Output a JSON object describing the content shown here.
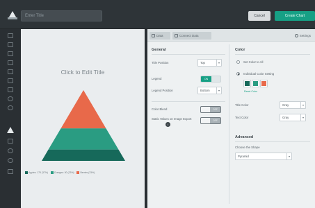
{
  "topbar": {
    "title_placeholder": "Enter Title",
    "cancel_label": "Cancel",
    "create_label": "Create Chart"
  },
  "rail": {
    "icons": [
      "bar-chart-icon",
      "column-chart-icon",
      "stacked-chart-icon",
      "line-chart-icon",
      "area-chart-icon",
      "scatter-icon",
      "bubble-icon",
      "pie-chart-icon",
      "donut-chart-icon",
      "pyramid-chart-icon",
      "funnel-chart-icon",
      "gauge-icon",
      "radar-chart-icon",
      "table-icon"
    ],
    "active_index": 9
  },
  "canvas": {
    "title": "Click to Edit Title",
    "legend": [
      {
        "label": "Apples: 175 (37%)",
        "color": "#16695a"
      },
      {
        "label": "Oranges: 50 (23%)",
        "color": "#2a9c82"
      },
      {
        "label": "Berries (33%)",
        "color": "#e8694a"
      }
    ]
  },
  "chart_data": {
    "type": "pyramid",
    "series": [
      {
        "name": "Apples",
        "value": 175,
        "percent": 37,
        "color": "#16695a"
      },
      {
        "name": "Oranges",
        "value": 50,
        "percent": 23,
        "color": "#2a9c82"
      },
      {
        "name": "Berries",
        "percent": 33,
        "color": "#e8694a"
      }
    ]
  },
  "panel": {
    "tabs": [
      {
        "label": "Data"
      },
      {
        "label": "Connect Data"
      }
    ],
    "settings_label": "Settings",
    "general": {
      "heading": "General",
      "title_position_label": "Title Position",
      "title_position_value": "Top",
      "legend_label": "Legend",
      "legend_toggle": "ON",
      "legend_position_label": "Legend Position",
      "legend_position_value": "Bottom",
      "color_blend_label": "Color Blend",
      "color_blend_toggle": "OFF",
      "static_values_label": "Static Values on Image Export",
      "static_values_toggle": "OFF",
      "info_icon": "i"
    },
    "color": {
      "heading": "Color",
      "set_all_label": "Set Color to All",
      "individual_label": "Individual Color Setting",
      "swatches": [
        "#16695a",
        "#2a9c82",
        "#e8694a"
      ],
      "reset_label": "Reset Color",
      "title_color_label": "Title Color",
      "title_color_value": "Gray",
      "text_color_label": "Text Color",
      "text_color_value": "Gray"
    },
    "advanced": {
      "heading": "Advanced",
      "shape_label": "Choose the Shape",
      "shape_value": "Pyramid"
    }
  }
}
